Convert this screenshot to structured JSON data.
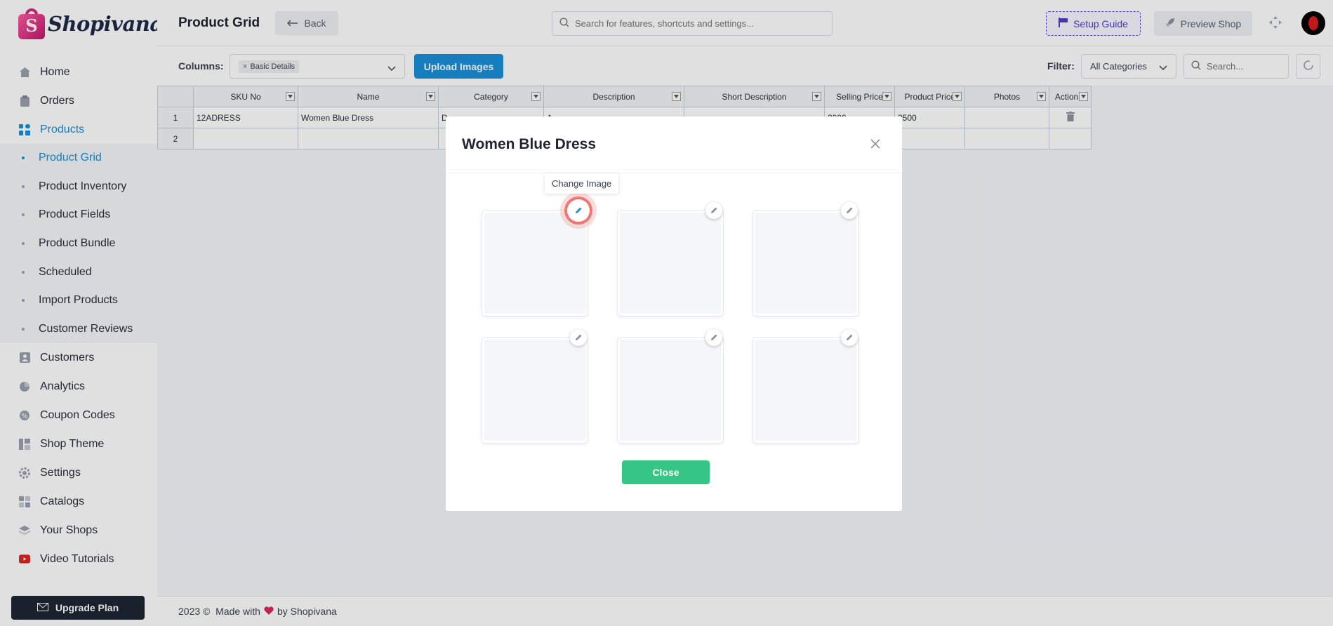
{
  "brand": {
    "name": "Shopivana"
  },
  "header": {
    "title": "Product Grid",
    "back_label": "Back",
    "search_placeholder": "Search for features, shortcuts and settings...",
    "setup_guide_label": "Setup Guide",
    "preview_shop_label": "Preview Shop"
  },
  "sidebar": {
    "items": [
      {
        "label": "Home",
        "icon": "home-icon"
      },
      {
        "label": "Orders",
        "icon": "clipboard-icon"
      },
      {
        "label": "Products",
        "icon": "products-icon",
        "active": true
      },
      {
        "label": "Customers",
        "icon": "user-icon"
      },
      {
        "label": "Analytics",
        "icon": "pie-chart-icon"
      },
      {
        "label": "Coupon Codes",
        "icon": "coupon-icon"
      },
      {
        "label": "Shop Theme",
        "icon": "layout-icon"
      },
      {
        "label": "Settings",
        "icon": "gear-icon"
      },
      {
        "label": "Catalogs",
        "icon": "catalog-icon"
      },
      {
        "label": "Your Shops",
        "icon": "layers-icon"
      },
      {
        "label": "Video Tutorials",
        "icon": "youtube-icon"
      }
    ],
    "sub_items": [
      {
        "label": "Product Grid",
        "active": true
      },
      {
        "label": "Product Inventory"
      },
      {
        "label": "Product Fields"
      },
      {
        "label": "Product Bundle"
      },
      {
        "label": "Scheduled"
      },
      {
        "label": "Import Products"
      },
      {
        "label": "Customer Reviews"
      }
    ],
    "upgrade_label": "Upgrade Plan"
  },
  "toolbar": {
    "columns_label": "Columns:",
    "columns_chip": "Basic Details",
    "upload_label": "Upload Images",
    "filter_label": "Filter:",
    "filter_value": "All Categories",
    "search_placeholder": "Search..."
  },
  "grid": {
    "columns": [
      "SKU No",
      "Name",
      "Category",
      "Description",
      "Short Description",
      "Selling Price",
      "Product Price",
      "Photos",
      "Action"
    ],
    "rows": [
      {
        "num": "1",
        "sku": "12ADRESS",
        "name": "Women Blue Dress",
        "category": "D",
        "description": "A ...",
        "short": "",
        "selling": "2000",
        "product": "2500",
        "photos": ""
      },
      {
        "num": "2",
        "sku": "",
        "name": "",
        "category": "",
        "description": "",
        "short": "",
        "selling": "",
        "product": "",
        "photos": ""
      }
    ]
  },
  "modal": {
    "title": "Women Blue Dress",
    "tooltip": "Change Image",
    "close_label": "Close"
  },
  "footer": {
    "year": "2023 ©",
    "made_with": "Made with",
    "by": "by Shopivana"
  },
  "colors": {
    "accent": "#1a8fd9",
    "close_button": "#35c584",
    "upgrade": "#1e2533",
    "highlight": "#f07672"
  }
}
